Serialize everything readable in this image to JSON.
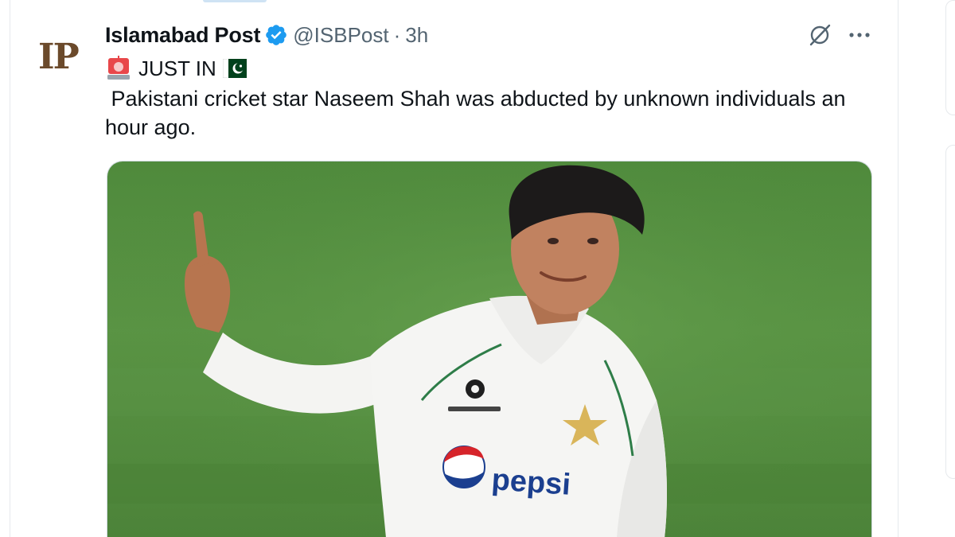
{
  "tweet": {
    "author": {
      "display_name": "Islamabad Post",
      "handle": "@ISBPost",
      "verified": true,
      "avatar_icon": "ip-logo-icon",
      "avatar_logo_text": "IP"
    },
    "separator": "·",
    "time": "3h",
    "header_icons": [
      "grok-icon",
      "more-options-icon"
    ],
    "line1": {
      "siren_icon": "rotating-light-emoji",
      "text": "JUST IN",
      "flag_icon": "pakistan-flag-emoji"
    },
    "body": " Pakistani cricket star Naseem Shah was abducted by unknown individuals an hour ago.",
    "media": {
      "kind": "photo",
      "jersey_texts": [
        "pepsi"
      ]
    }
  },
  "colors": {
    "text": "#0f1419",
    "secondary": "#536471",
    "verified": "#1d9bf0",
    "border": "#cfd9de",
    "field_green": "#4f8a3c",
    "flag_green": "#01411c"
  }
}
